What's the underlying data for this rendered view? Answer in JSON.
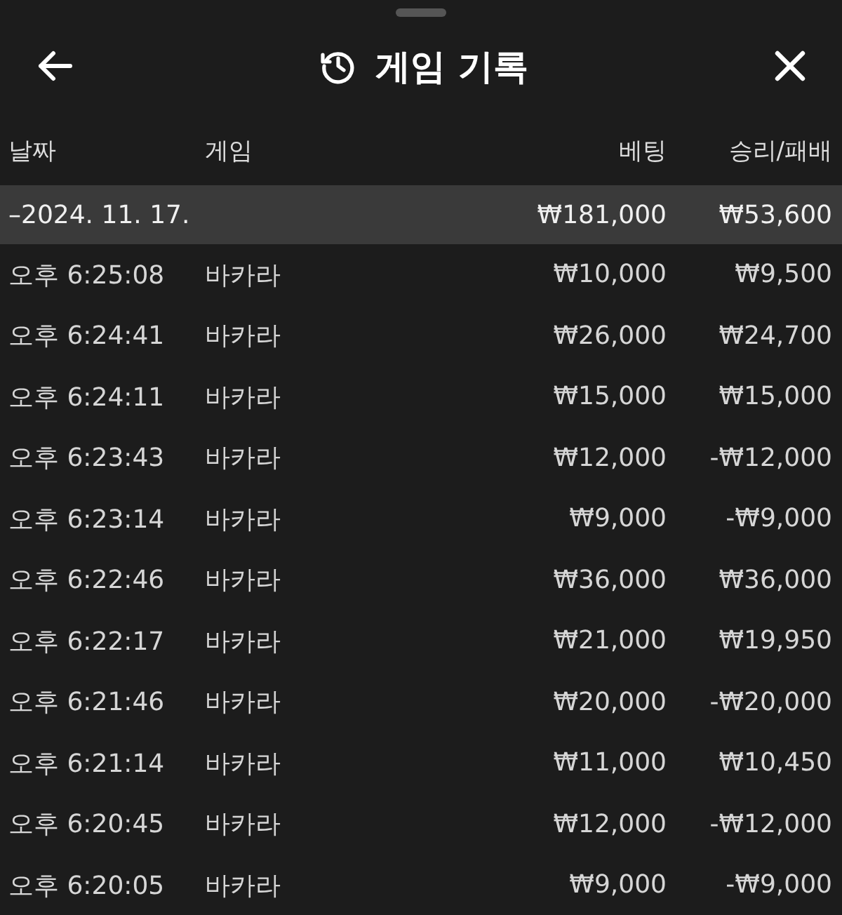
{
  "header": {
    "title": "게임 기록"
  },
  "table": {
    "columns": [
      "날짜",
      "게임",
      "베팅",
      "승리/패배"
    ],
    "group": {
      "date": "–2024. 11. 17.",
      "bet": "₩181,000",
      "result": "₩53,600"
    },
    "rows": [
      {
        "time": "오후 6:25:08",
        "game": "바카라",
        "bet": "₩10,000",
        "result": "₩9,500"
      },
      {
        "time": "오후 6:24:41",
        "game": "바카라",
        "bet": "₩26,000",
        "result": "₩24,700"
      },
      {
        "time": "오후 6:24:11",
        "game": "바카라",
        "bet": "₩15,000",
        "result": "₩15,000"
      },
      {
        "time": "오후 6:23:43",
        "game": "바카라",
        "bet": "₩12,000",
        "result": "-₩12,000"
      },
      {
        "time": "오후 6:23:14",
        "game": "바카라",
        "bet": "₩9,000",
        "result": "-₩9,000"
      },
      {
        "time": "오후 6:22:46",
        "game": "바카라",
        "bet": "₩36,000",
        "result": "₩36,000"
      },
      {
        "time": "오후 6:22:17",
        "game": "바카라",
        "bet": "₩21,000",
        "result": "₩19,950"
      },
      {
        "time": "오후 6:21:46",
        "game": "바카라",
        "bet": "₩20,000",
        "result": "-₩20,000"
      },
      {
        "time": "오후 6:21:14",
        "game": "바카라",
        "bet": "₩11,000",
        "result": "₩10,450"
      },
      {
        "time": "오후 6:20:45",
        "game": "바카라",
        "bet": "₩12,000",
        "result": "-₩12,000"
      },
      {
        "time": "오후 6:20:05",
        "game": "바카라",
        "bet": "₩9,000",
        "result": "-₩9,000"
      }
    ]
  }
}
